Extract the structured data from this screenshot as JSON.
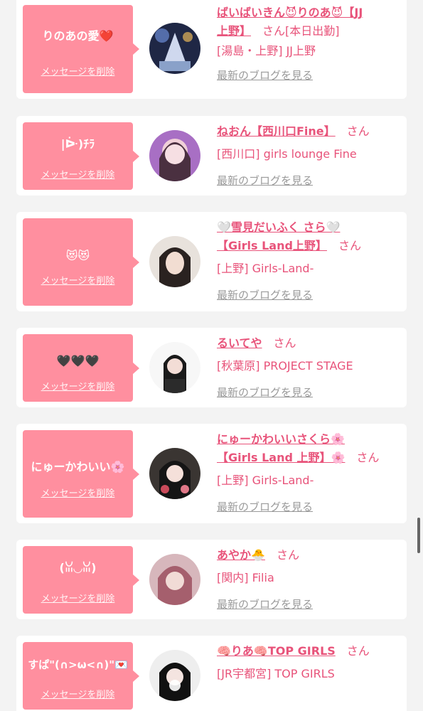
{
  "cards": [
    {
      "message": "りのあの愛❤️",
      "delete_label": "メッセージを削除",
      "name_lines": [
        "ばいばいきん😈りのあ😈【JJ",
        "上野】"
      ],
      "san": "さん",
      "san_suffix": "[本日出勤]",
      "shop": "[湯島・上野] JJ上野",
      "blog": "最新のブログを見る",
      "avatar_color": "#4a5a86"
    },
    {
      "message": "|ᐕ)ﾁﾗ",
      "delete_label": "メッセージを削除",
      "name_lines": [
        "ねおん【西川口Fine】"
      ],
      "san": "さん",
      "shop": "[西川口] girls lounge Fine",
      "blog": "最新のブログを見る",
      "avatar_color": "#b37cc8"
    },
    {
      "message": "😻😻",
      "delete_label": "メッセージを削除",
      "name_lines": [
        "🤍雪見だいふく さら🤍",
        "【Girls Land上野】"
      ],
      "san": "さん",
      "shop": "[上野] Girls-Land-",
      "blog": "最新のブログを見る",
      "avatar_color": "#d8cfc6"
    },
    {
      "message": "🖤🖤🖤",
      "delete_label": "メッセージを削除",
      "name_lines": [
        "るいてや"
      ],
      "san": "さん",
      "shop": "[秋葉原] PROJECT STAGE",
      "blog": "最新のブログを見る",
      "avatar_color": "#f2f2f2"
    },
    {
      "message": "にゅーかわいい🌸",
      "delete_label": "メッセージを削除",
      "name_lines": [
        "にゅーかわいいさくら🌸",
        "【Girls Land 上野】🌸"
      ],
      "san": "さん",
      "shop": "[上野] Girls-Land-",
      "blog": "最新のブログを見る",
      "avatar_color": "#33302e"
    },
    {
      "message": "(ꈍ◡ꈍ)",
      "delete_label": "メッセージを削除",
      "name_lines": [
        "あやか🐣"
      ],
      "san": "さん",
      "shop": "[関内] Filia",
      "blog": "最新のブログを見る",
      "avatar_color": "#c79aa0"
    },
    {
      "message": "すぱ\"(∩>ω<∩)\"💌",
      "delete_label": "メッセージを削除",
      "name_lines": [
        "🧠りあ🧠TOP GIRLS"
      ],
      "san": "さん",
      "shop": "[JR宇都宮] TOP GIRLS",
      "blog": "最新のブログを見る",
      "avatar_color": "#e9e9e9"
    }
  ]
}
